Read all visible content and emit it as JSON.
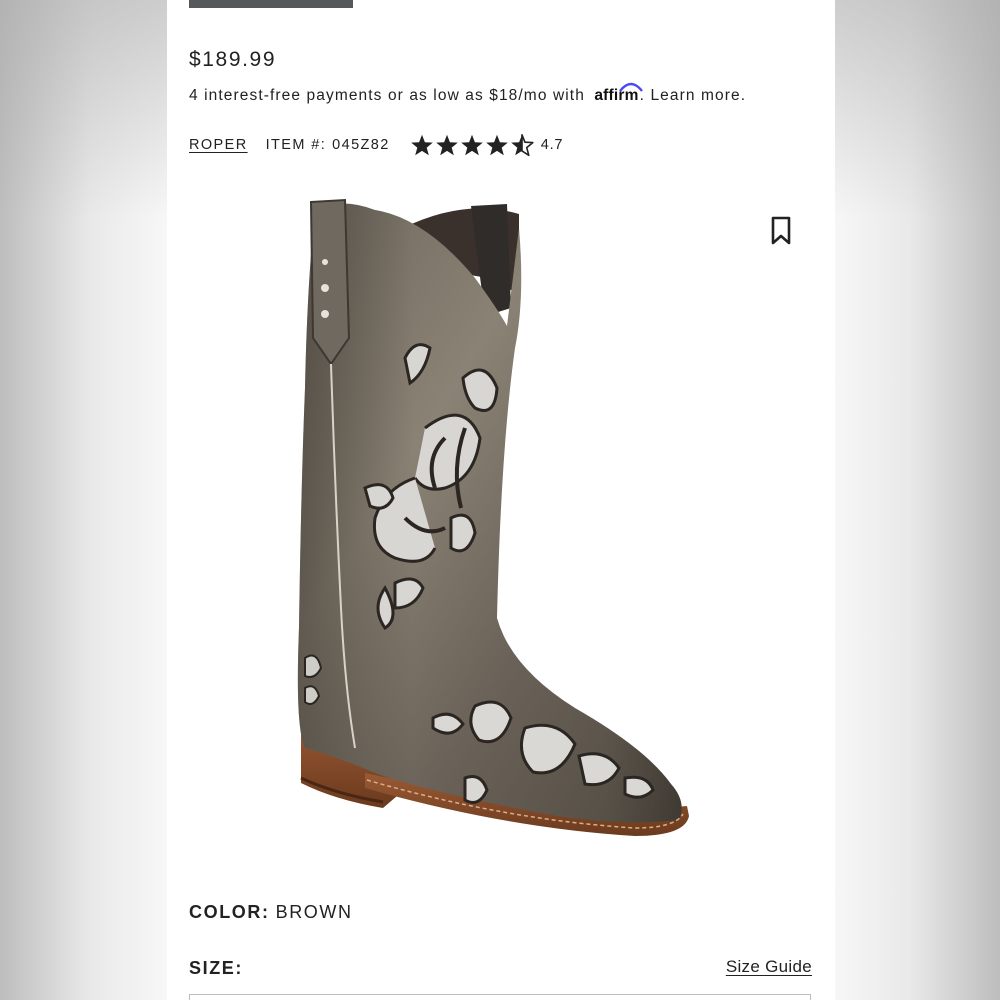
{
  "product": {
    "price": "$189.99",
    "payments_prefix": "4 interest-free payments or as low as $18/mo with",
    "affirm_brand": "affirm",
    "payments_suffix": ".",
    "learn_more": "Learn more.",
    "brand": "ROPER",
    "item_label": "ITEM #:",
    "item_number": "045Z82",
    "rating": 4.7,
    "rating_text": "4.7",
    "color_label": "COLOR:",
    "color_value": "BROWN",
    "size_label": "SIZE:",
    "size_guide": "Size Guide"
  },
  "colors": {
    "panel_bg": "#ffffff",
    "text": "#222222",
    "star": "#222222",
    "top_strip": "#55595c"
  },
  "icons": {
    "bookmark": "bookmark-icon",
    "star": "star-icon",
    "half_star": "half-star-icon"
  }
}
